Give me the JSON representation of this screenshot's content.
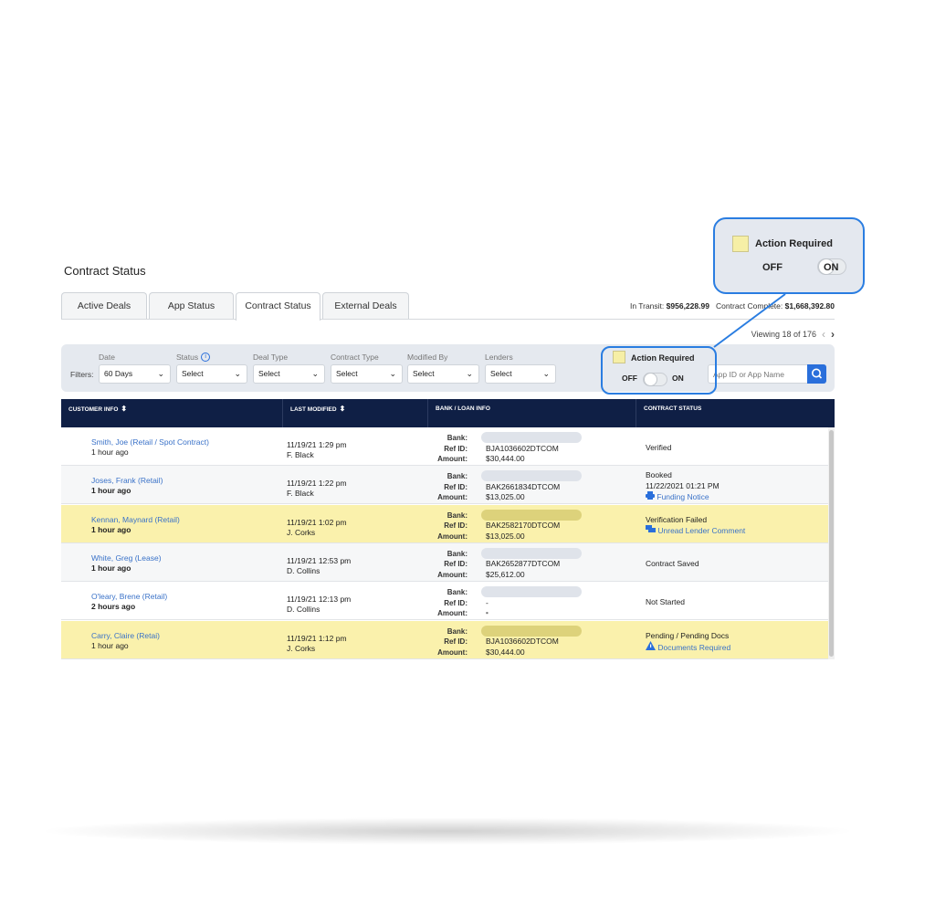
{
  "page": {
    "title": "Contract Status"
  },
  "tabs": [
    {
      "label": "Active Deals"
    },
    {
      "label": "App Status"
    },
    {
      "label": "Contract Status",
      "active": true
    },
    {
      "label": "External Deals"
    }
  ],
  "totals": {
    "in_transit_label": "In Transit:",
    "in_transit": "$956,228.99",
    "complete_label": "Contract Complete:",
    "complete": "$1,668,392.80"
  },
  "pagination": {
    "text": "Viewing 18 of 176",
    "prev": "‹",
    "next": "›"
  },
  "filters": {
    "label": "Filters:",
    "fields": [
      {
        "label": "Date",
        "value": "60 Days"
      },
      {
        "label": "Status",
        "value": "Select",
        "info": "i"
      },
      {
        "label": "Deal Type",
        "value": "Select"
      },
      {
        "label": "Contract Type",
        "value": "Select"
      },
      {
        "label": "Modified By",
        "value": "Select"
      },
      {
        "label": "Lenders",
        "value": "Select"
      }
    ],
    "action_required": {
      "label": "Action Required",
      "off": "OFF",
      "on": "ON",
      "state": "off"
    },
    "search": {
      "placeholder": "App ID or App Name"
    }
  },
  "callout": {
    "label": "Action Required",
    "off": "OFF",
    "on": "ON"
  },
  "table": {
    "columns": [
      "CUSTOMER INFO",
      "LAST MODIFIED",
      "BANK / LOAN INFO",
      "CONTRACT STATUS"
    ],
    "bank_labels": {
      "bank": "Bank:",
      "ref": "Ref ID:",
      "amount": "Amount:"
    },
    "rows": [
      {
        "name": "Smith, Joe (Retail / Spot Contract)",
        "ago": "1 hour ago",
        "date": "11/19/21  1:29 pm",
        "by": "F. Black",
        "ref": "BJA1036602DTCOM",
        "amount": "$30,444.00",
        "status": "Verified",
        "highlight": "white"
      },
      {
        "name": "Joses, Frank (Retail)",
        "ago": "1 hour ago",
        "date": "11/19/21  1:22 pm",
        "by": "F. Black",
        "ref": "BAK2661834DTCOM",
        "amount": "$13,025.00",
        "status": "Booked",
        "status_line2": "11/22/2021  01:21 PM",
        "link": "Funding Notice",
        "link_icon": "printer-icon",
        "highlight": "grey"
      },
      {
        "name": "Kennan, Maynard (Retail)",
        "ago": "1 hour ago",
        "date": "11/19/21  1:02 pm",
        "by": "J. Corks",
        "ref": "BAK2582170DTCOM",
        "amount": "$13,025.00",
        "status": "Verification Failed",
        "link": "Unread Lender Comment",
        "link_icon": "comment-icon",
        "highlight": "yellow"
      },
      {
        "name": "White, Greg (Lease)",
        "ago": "1 hour ago",
        "date": "11/19/21  12:53 pm",
        "by": "D. Collins",
        "ref": "BAK2652877DTCOM",
        "amount": "$25,612.00",
        "status": "Contract Saved",
        "highlight": "grey"
      },
      {
        "name": "O'leary, Brene (Retail)",
        "ago": "2 hours ago",
        "date": "11/19/21  12:13 pm",
        "by": "D. Collins",
        "ref": "- -",
        "amount": "- -",
        "status": "Not Started",
        "highlight": "white"
      },
      {
        "name": "Carry, Claire (Retai)",
        "ago": "1 hour ago",
        "date": "11/19/21  1:12 pm",
        "by": "J. Corks",
        "ref": "BJA1036602DTCOM",
        "amount": "$30,444.00",
        "status": "Pending / Pending Docs",
        "link": "Documents Required",
        "link_icon": "warning-icon",
        "highlight": "yellow"
      }
    ]
  },
  "colors": {
    "header_bg": "#0f1f45",
    "highlight_row": "#faf1ac",
    "accent": "#2a7de1",
    "link": "#3a72c8"
  }
}
